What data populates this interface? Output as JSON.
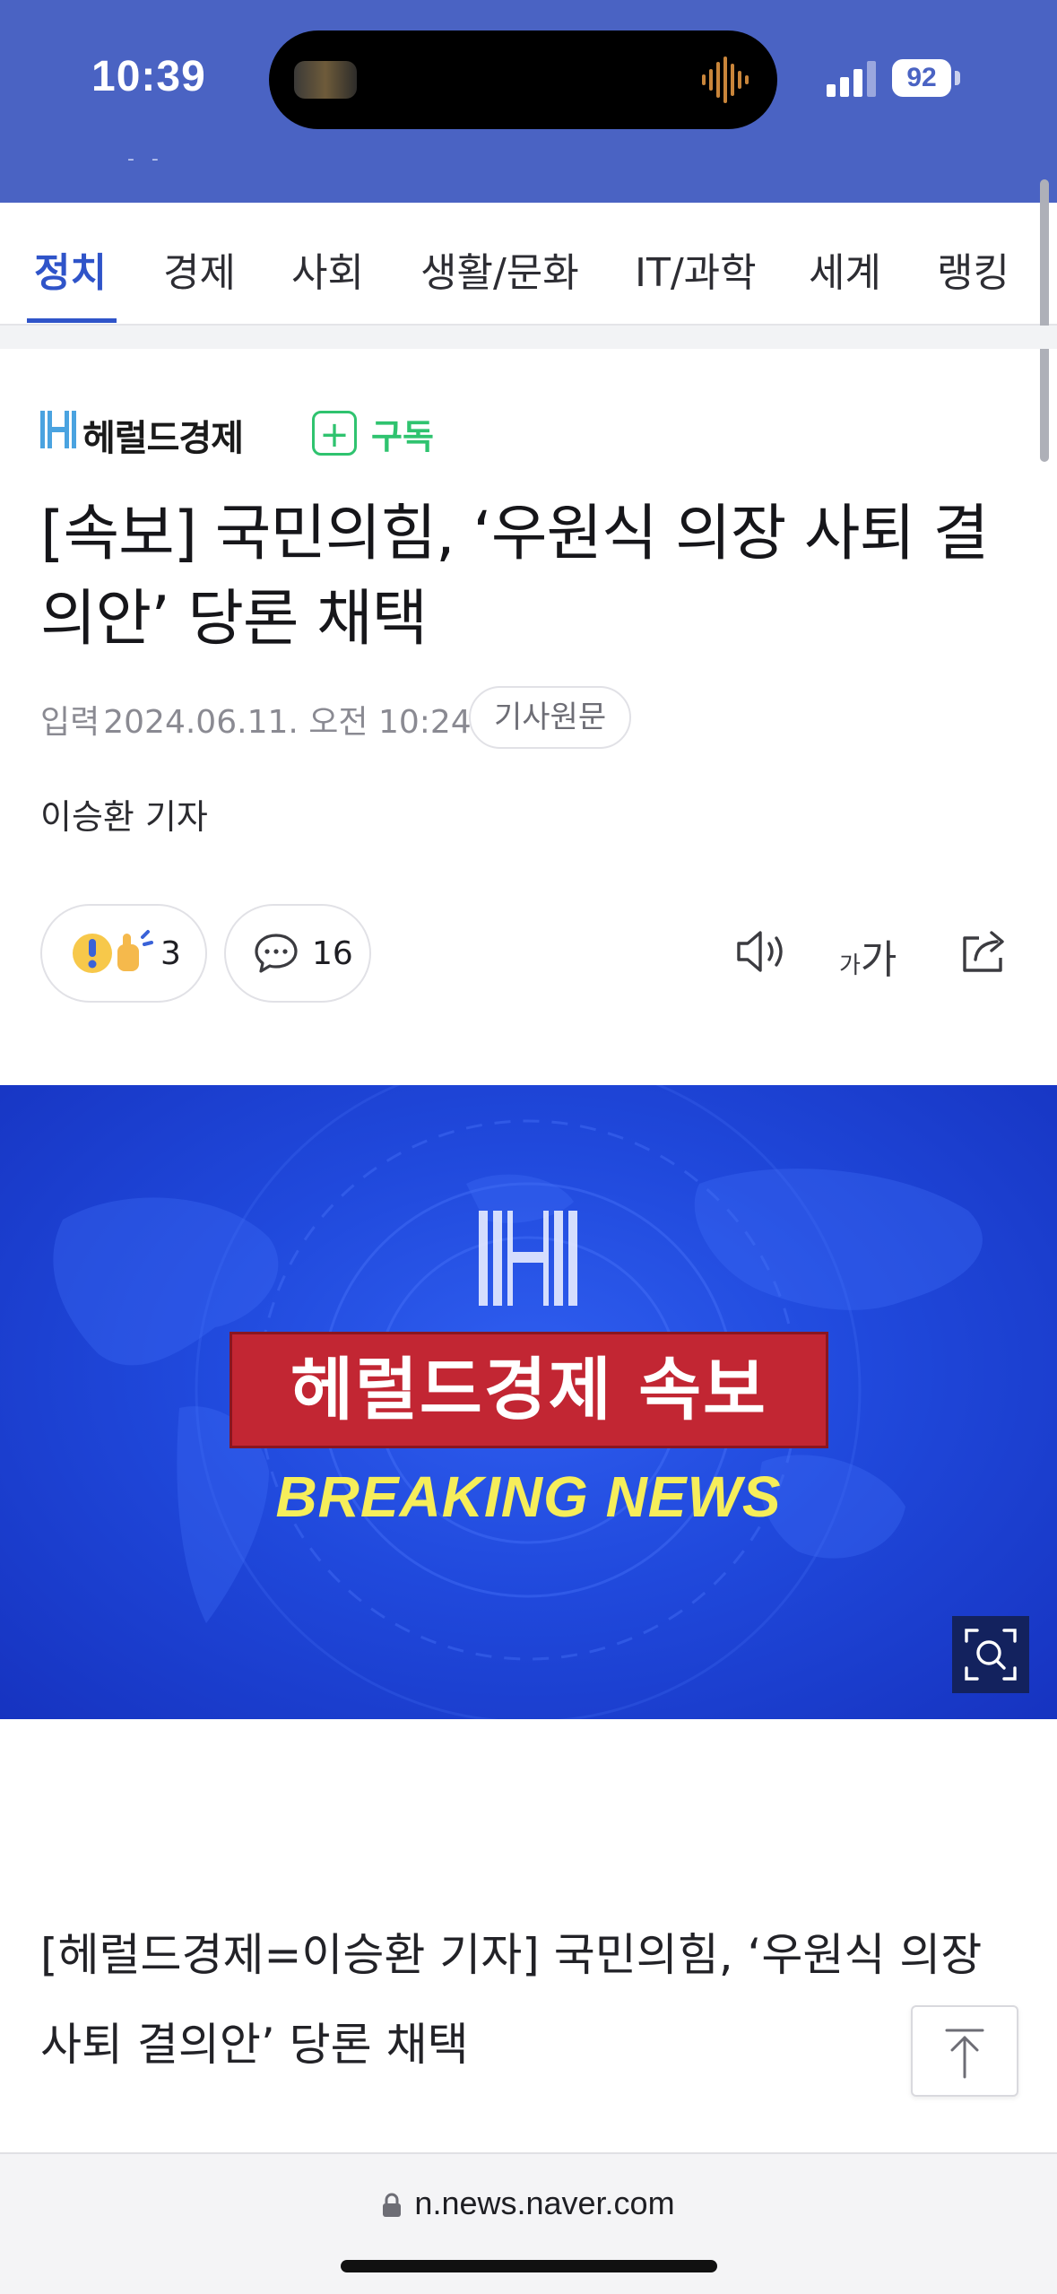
{
  "status_bar": {
    "time": "10:39",
    "battery": "92",
    "indicator": "- -"
  },
  "tabs": [
    {
      "label": "정치",
      "active": true
    },
    {
      "label": "경제"
    },
    {
      "label": "사회"
    },
    {
      "label": "생활/문화"
    },
    {
      "label": "IT/과학"
    },
    {
      "label": "세계"
    },
    {
      "label": "랭킹"
    }
  ],
  "press": {
    "name": "헤럴드경제",
    "subscribe_label": "구독",
    "subscribe_icon": "+"
  },
  "article": {
    "headline": "[속보] 국민의힘, ‘우원식 의장 사퇴 결의안’ 당론 채택",
    "date_label": "입력",
    "date": "2024.06.11. 오전 10:24",
    "source_button": "기사원문",
    "reporter": "이승환 기자",
    "body": "[헤럴드경제=이승환 기자] 국민의힘, ‘우원식 의장 사퇴 결의안’ 당론 채택"
  },
  "actions": {
    "reaction_count": "3",
    "comment_count": "16",
    "font_size_small": "가",
    "font_size_large": "가"
  },
  "image": {
    "banner_text": "헤럴드경제 속보",
    "subtitle": "BREAKING NEWS"
  },
  "browser": {
    "url": "n.news.naver.com"
  },
  "colors": {
    "accent": "#2f54c9",
    "status_bg": "#4a63c3",
    "subscribe": "#2fc36f",
    "banner_red": "#c22633",
    "breaking_yellow": "#f6ee5a"
  }
}
